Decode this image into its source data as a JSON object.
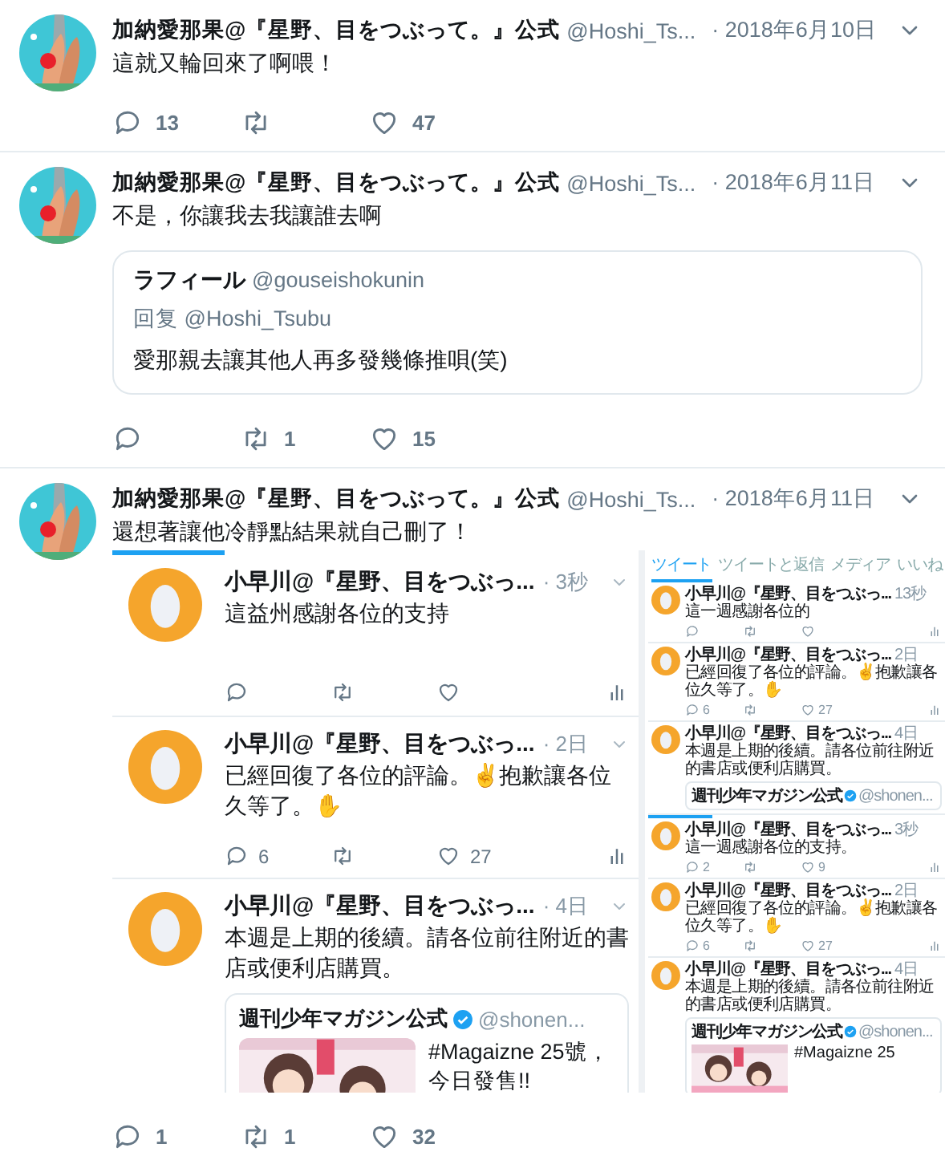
{
  "tweets": [
    {
      "author": "加納愛那果@『星野、目をつぶって。』公式",
      "handle": "@Hoshi_Ts...",
      "date": "· 2018年6月10日",
      "text": "這就又輪回來了啊喂！",
      "actions": {
        "reply": "13",
        "like": "47"
      }
    },
    {
      "author": "加納愛那果@『星野、目をつぶって。』公式",
      "handle": "@Hoshi_Ts...",
      "date": "· 2018年6月11日",
      "text": "不是，你讓我去我讓誰去啊",
      "quote": {
        "author": "ラフィール",
        "handle": "@gouseishokunin",
        "reply_to": "回复 @Hoshi_Tsubu",
        "text": "愛那親去讓其他人再多發幾條推唄(笑)"
      },
      "actions": {
        "retweet": "1",
        "like": "15"
      }
    },
    {
      "author": "加納愛那果@『星野、目をつぶって。』公式",
      "handle": "@Hoshi_Ts...",
      "date": "· 2018年6月11日",
      "text": "還想著讓他冷靜點結果就自己刪了！",
      "screenshot": {
        "feed": [
          {
            "author": "小早川@『星野、目をつぶっ...",
            "time": "· 3秒",
            "text": "這益州感謝各位的支持"
          },
          {
            "author": "小早川@『星野、目をつぶっ...",
            "time": "· 2日",
            "text": "已經回復了各位的評論。✌抱歉讓各位久等了。✋",
            "actions": {
              "reply": "6",
              "like": "27"
            }
          },
          {
            "author": "小早川@『星野、目をつぶっ...",
            "time": "· 4日",
            "text": "本週是上期的後續。請各位前往附近的書店或便利店購買。",
            "quote": {
              "author": "週刊少年マガジン公式",
              "verified": true,
              "handle": "@shonen...",
              "text": "#Magaizne 25號，今日發售!!"
            }
          }
        ],
        "mini": {
          "tabs": [
            {
              "label": "ツイート",
              "selected": true
            },
            {
              "label": "ツイートと返信",
              "selected": false
            },
            {
              "label": "メディア",
              "selected": false
            },
            {
              "label": "いいね",
              "selected": false
            }
          ],
          "sections": [
            [
              {
                "author": "小早川@『星野、目をつぶっ...",
                "time": "13秒",
                "text": "這一週感謝各位的"
              },
              {
                "author": "小早川@『星野、目をつぶっ...",
                "time": "2日",
                "text": "已經回復了各位的評論。✌抱歉讓各位久等了。✋",
                "actions": {
                  "reply": "6",
                  "like": "27"
                }
              },
              {
                "author": "小早川@『星野、目をつぶっ...",
                "time": "4日",
                "text": "本週是上期的後續。請各位前往附近的書店或便利店購買。",
                "quote": {
                  "author": "週刊少年マガジン公式",
                  "verified": true,
                  "handle": "@shonen..."
                }
              }
            ],
            [
              {
                "author": "小早川@『星野、目をつぶっ...",
                "time": "3秒",
                "text": "這一週感謝各位的支持。",
                "actions": {
                  "reply": "2",
                  "like": "9"
                }
              },
              {
                "author": "小早川@『星野、目をつぶっ...",
                "time": "2日",
                "text": "已經回復了各位的評論。✌抱歉讓各位久等了。✋",
                "actions": {
                  "reply": "6",
                  "like": "27"
                }
              },
              {
                "author": "小早川@『星野、目をつぶっ...",
                "time": "4日",
                "text": "本週是上期的後續。請各位前往附近的書店或便利店購買。",
                "quote": {
                  "author": "週刊少年マガジン公式",
                  "verified": true,
                  "handle": "@shonen...",
                  "text": "#Magaizne 25"
                }
              }
            ]
          ]
        }
      },
      "actions": {
        "reply": "1",
        "retweet": "1",
        "like": "32"
      }
    }
  ]
}
